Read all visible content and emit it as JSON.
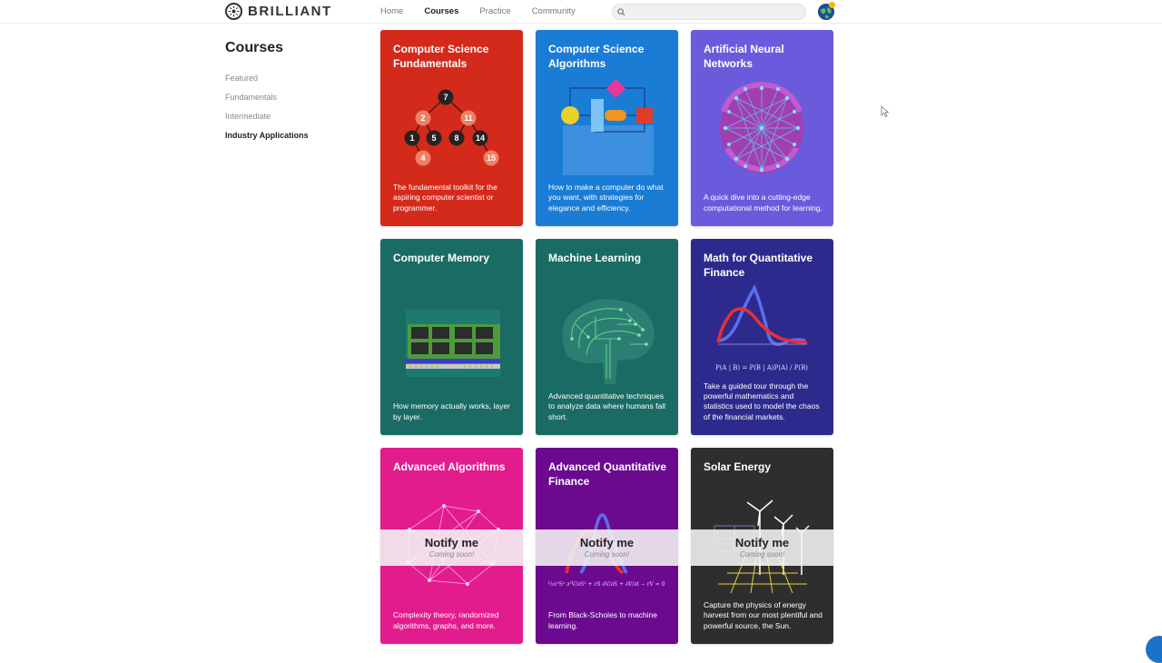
{
  "header": {
    "brand": "BRILLIANT",
    "nav": [
      "Home",
      "Courses",
      "Practice",
      "Community"
    ],
    "active_nav": "Courses",
    "search": {
      "value": "",
      "placeholder": ""
    }
  },
  "sidebar": {
    "title": "Courses",
    "items": [
      {
        "label": "Featured"
      },
      {
        "label": "Fundamentals"
      },
      {
        "label": "Intermediate"
      },
      {
        "label": "Industry Applications"
      }
    ]
  },
  "courses": [
    {
      "title": "Computer Science Fundamentals",
      "description": "The fundamental toolkit for the aspiring computer scientist or programmer.",
      "color": "#d42a1b"
    },
    {
      "title": "Computer Science Algorithms",
      "description": "How to make a computer do what you want, with strategies for elegance and efficiency.",
      "color": "#1a7cd4"
    },
    {
      "title": "Artificial Neural Networks",
      "description": "A quick dive into a cutting-edge computational method for learning.",
      "color": "#6a5bdc"
    },
    {
      "title": "Computer Memory",
      "description": "How memory actually works, layer by layer.",
      "color": "#1a6b63"
    },
    {
      "title": "Machine Learning",
      "description": "Advanced quantitative techniques to analyze data where humans fall short.",
      "color": "#1a6b63"
    },
    {
      "title": "Math for Quantitative Finance",
      "description": "Take a guided tour through the powerful mathematics and statistics used to model the chaos of the financial markets.",
      "color": "#2d2a8e"
    },
    {
      "title": "Advanced Algorithms",
      "description": "Complexity theory, randomized algorithms, graphs, and more.",
      "color": "#e31c8e"
    },
    {
      "title": "Advanced Quantitative Finance",
      "description": "From Black-Scholes to machine learning.",
      "color": "#6b0a8f"
    },
    {
      "title": "Solar Energy",
      "description": "Capture the physics of energy harvest from our most plentiful and powerful source, the Sun.",
      "color": "#2e2e2e"
    }
  ],
  "tree_nodes": [
    "7",
    "2",
    "11",
    "1",
    "5",
    "8",
    "14",
    "4",
    "15"
  ],
  "bayes_formula": "P(A | B) = P(B | A)P(A) / P(B)",
  "black_scholes_formula": "½σ²S² ∂²V/∂S² + rS ∂V/∂S + ∂V/∂t − rV = 0",
  "notify": {
    "label": "Notify me",
    "sub": "Coming soon!"
  }
}
